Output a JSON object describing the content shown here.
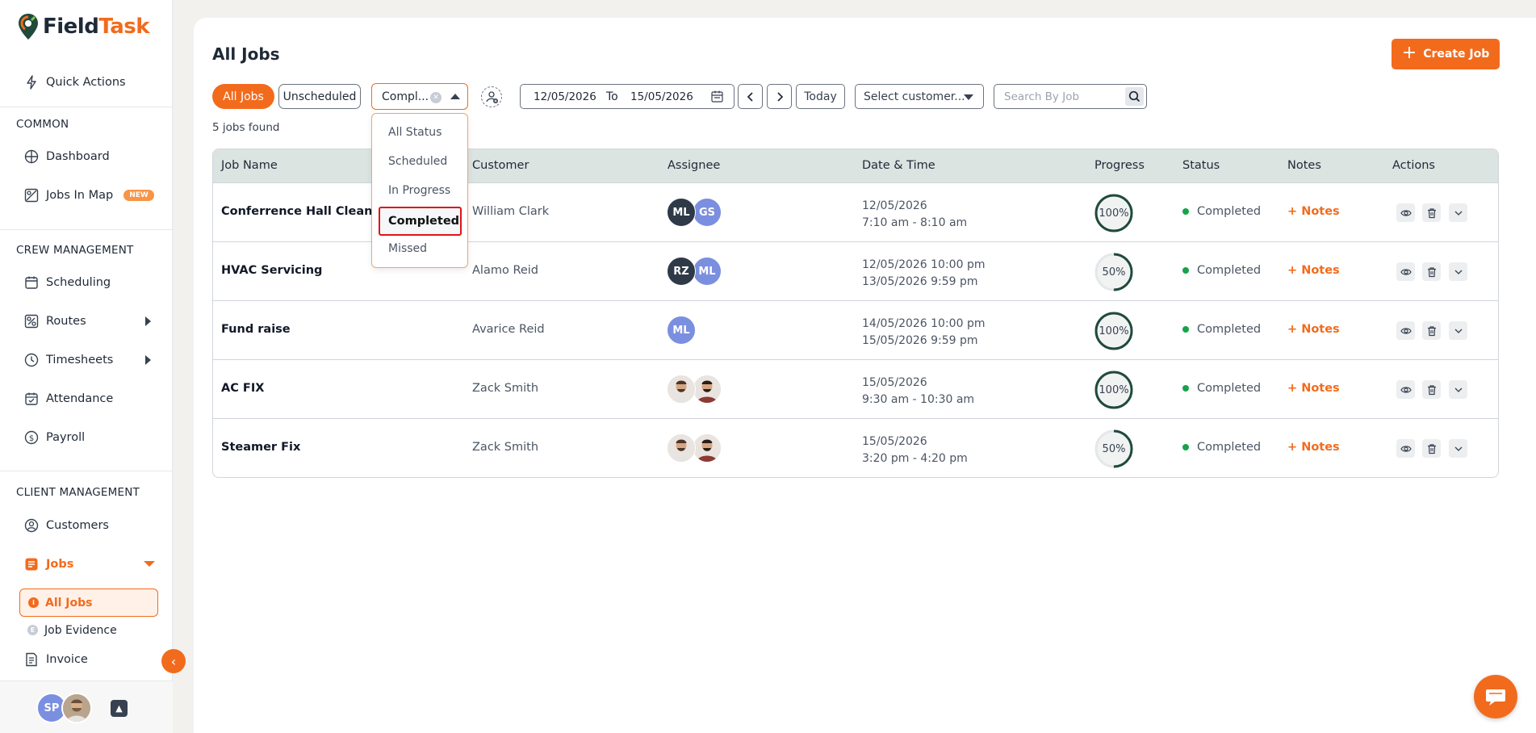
{
  "brand": {
    "part1": "Field",
    "part2": "Task"
  },
  "sidebar": {
    "quick_actions": "Quick Actions",
    "sections": {
      "common": "COMMON",
      "crew": "CREW MANAGEMENT",
      "client": "CLIENT MANAGEMENT"
    },
    "items": {
      "dashboard": "Dashboard",
      "jobs_in_map": "Jobs In Map",
      "new_badge": "NEW",
      "scheduling": "Scheduling",
      "routes": "Routes",
      "timesheets": "Timesheets",
      "attendance": "Attendance",
      "payroll": "Payroll",
      "customers": "Customers",
      "jobs": "Jobs",
      "all_jobs": "All Jobs",
      "job_evidence": "Job Evidence",
      "invoice": "Invoice"
    },
    "user": {
      "initials": "SP"
    }
  },
  "header": {
    "title": "All Jobs",
    "create_button": "Create Job"
  },
  "filters": {
    "all_jobs": "All Jobs",
    "unscheduled": "Unscheduled",
    "status_value": "Compl...",
    "status_options": [
      "All Status",
      "Scheduled",
      "In Progress",
      "Completed",
      "Missed"
    ],
    "status_selected": "Completed",
    "date_from": "12/05/2026",
    "date_to_label": "To",
    "date_to": "15/05/2026",
    "today": "Today",
    "customer_placeholder": "Select customer...",
    "search_placeholder": "Search By Job"
  },
  "results_text": "5 jobs found",
  "table": {
    "columns": [
      "Job Name",
      "Customer",
      "Assignee",
      "Date & Time",
      "Progress",
      "Status",
      "Notes",
      "Actions"
    ],
    "rows": [
      {
        "job": "Conferrence Hall Cleaning",
        "customer": "William Clark",
        "assignees": [
          {
            "initials": "ML",
            "style": "dark"
          },
          {
            "initials": "GS",
            "style": "blue"
          }
        ],
        "date1": "12/05/2026",
        "date2": "7:10 am - 8:10 am",
        "progress": "100%",
        "progress_value": 100,
        "status": "Completed",
        "notes": "+ Notes"
      },
      {
        "job": "HVAC Servicing",
        "customer": "Alamo Reid",
        "assignees": [
          {
            "initials": "RZ",
            "style": "dark"
          },
          {
            "initials": "ML",
            "style": "blue"
          }
        ],
        "date1": "12/05/2026 10:00 pm",
        "date2": "13/05/2026 9:59 pm",
        "progress": "50%",
        "progress_value": 50,
        "status": "Completed",
        "notes": "+ Notes"
      },
      {
        "job": "Fund raise",
        "customer": "Avarice Reid",
        "assignees": [
          {
            "initials": "ML",
            "style": "blue"
          }
        ],
        "date1": "14/05/2026 10:00 pm",
        "date2": "15/05/2026 9:59 pm",
        "progress": "100%",
        "progress_value": 100,
        "status": "Completed",
        "notes": "+ Notes"
      },
      {
        "job": "AC FIX",
        "customer": "Zack Smith",
        "assignees": [
          {
            "initials": "",
            "style": "photo"
          },
          {
            "initials": "",
            "style": "photo"
          }
        ],
        "date1": "15/05/2026",
        "date2": "9:30 am - 10:30 am",
        "progress": "100%",
        "progress_value": 100,
        "status": "Completed",
        "notes": "+ Notes"
      },
      {
        "job": "Steamer Fix",
        "customer": "Zack Smith",
        "assignees": [
          {
            "initials": "",
            "style": "photo"
          },
          {
            "initials": "",
            "style": "photo"
          }
        ],
        "date1": "15/05/2026",
        "date2": "3:20 pm - 4:20 pm",
        "progress": "50%",
        "progress_value": 50,
        "status": "Completed",
        "notes": "+ Notes"
      }
    ]
  },
  "colors": {
    "accent": "#f26b1d",
    "status_green": "#16a34a",
    "progress_ring": "#1f4a3c",
    "header_bg": "#dbe4e1"
  },
  "icons": [
    "bolt-icon",
    "dashboard-icon",
    "map-icon",
    "calendar-icon",
    "route-icon",
    "clock-icon",
    "attendance-icon",
    "payroll-icon",
    "customers-icon",
    "jobs-icon",
    "invoice-icon",
    "search-icon",
    "eye-icon",
    "trash-icon",
    "chevron-down-icon",
    "chat-icon"
  ]
}
